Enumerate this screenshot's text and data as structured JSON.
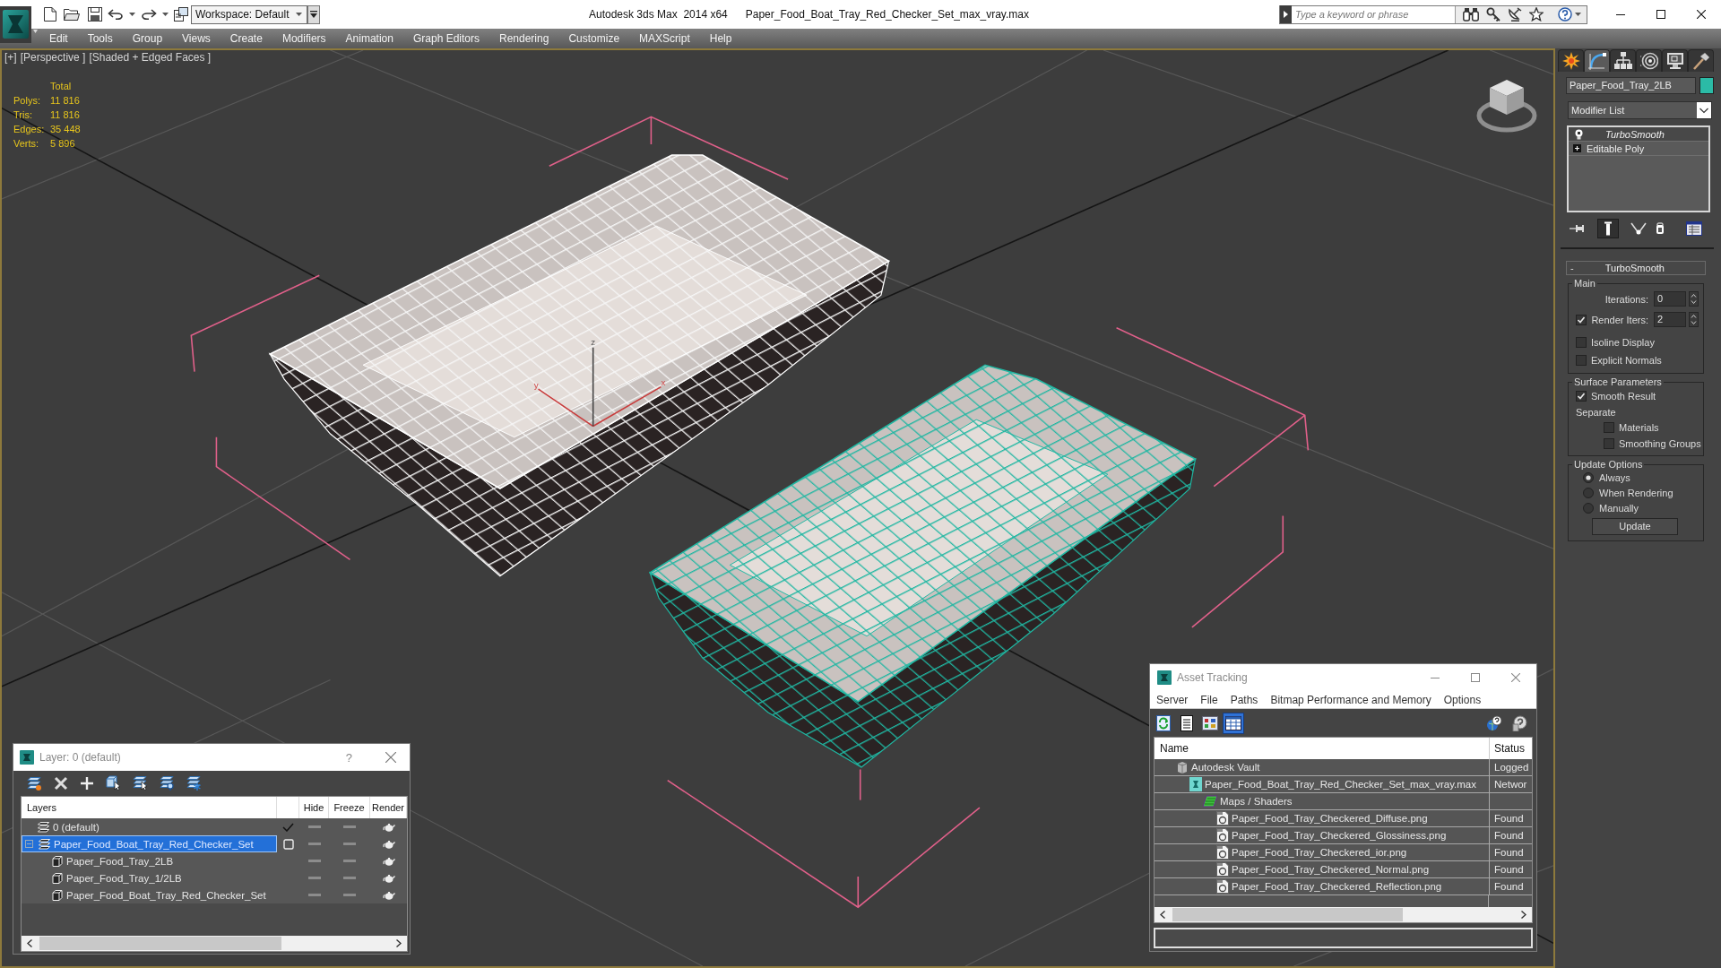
{
  "title_bar": {
    "workspace": "Workspace: Default",
    "app_title": "Autodesk 3ds Max  2014 x64",
    "file_name": "Paper_Food_Boat_Tray_Red_Checker_Set_max_vray.max",
    "search": {
      "placeholder": "Type a keyword or phrase"
    }
  },
  "menu_bar": [
    "Edit",
    "Tools",
    "Group",
    "Views",
    "Create",
    "Modifiers",
    "Animation",
    "Graph Editors",
    "Rendering",
    "Customize",
    "MAXScript",
    "Help"
  ],
  "viewport": {
    "labels": [
      "[+]",
      "[Perspective ]",
      "[Shaded + Edged Faces ]"
    ],
    "stats": {
      "header": "Total",
      "rows": [
        {
          "label": "Polys:",
          "value": "11 816"
        },
        {
          "label": "Tris:",
          "value": "11 816"
        },
        {
          "label": "Edges:",
          "value": "35 448"
        },
        {
          "label": "Verts:",
          "value": "5 896"
        }
      ]
    },
    "axis_labels": [
      "x",
      "y",
      "z"
    ],
    "objects": [
      {
        "kind": "tray",
        "selected": true
      },
      {
        "kind": "tray",
        "selected": false
      }
    ]
  },
  "command_panel": {
    "tabs": [
      {
        "kind": "create",
        "selected": false
      },
      {
        "kind": "modify",
        "selected": true
      },
      {
        "kind": "hierarchy",
        "selected": false
      },
      {
        "kind": "motion",
        "selected": false
      },
      {
        "kind": "display",
        "selected": false
      },
      {
        "kind": "utilities",
        "selected": false
      }
    ],
    "object": {
      "name": "Paper_Food_Tray_2LB",
      "color": "#2bbba6"
    },
    "modifier_list": "Modifier List",
    "stack": [
      {
        "kind": "modifier",
        "label": "TurboSmooth",
        "selected": true
      },
      {
        "kind": "base",
        "label": "Editable Poly",
        "selected": false
      }
    ],
    "stack_tools": [
      {
        "kind": "pin",
        "on": false
      },
      {
        "kind": "end_result",
        "on": true
      },
      {
        "kind": "unique",
        "on": false
      },
      {
        "kind": "remove",
        "on": false
      },
      {
        "kind": "configure",
        "on": false
      }
    ],
    "rollout": {
      "toggle": "-",
      "title": "TurboSmooth",
      "groups": [
        {
          "title": "Main",
          "controls": [
            {
              "kind": "spinner",
              "label": "Iterations:",
              "value": "0"
            },
            {
              "kind": "check_spinner",
              "label": "Render Iters:",
              "checked": true,
              "value": "2"
            },
            {
              "kind": "checkbox",
              "label": "Isoline Display",
              "checked": false
            },
            {
              "kind": "checkbox",
              "label": "Explicit Normals",
              "checked": false
            }
          ]
        },
        {
          "title": "Surface Parameters",
          "controls": [
            {
              "kind": "checkbox",
              "label": "Smooth Result",
              "checked": true
            },
            {
              "kind": "subgroup",
              "label": "Separate",
              "children": [
                {
                  "kind": "checkbox",
                  "label": "Materials",
                  "checked": false
                },
                {
                  "kind": "checkbox",
                  "label": "Smoothing Groups",
                  "checked": false
                }
              ]
            }
          ]
        },
        {
          "title": "Update Options",
          "controls": [
            {
              "kind": "radio",
              "label": "Always",
              "selected": true
            },
            {
              "kind": "radio",
              "label": "When Rendering",
              "selected": false
            },
            {
              "kind": "radio",
              "label": "Manually",
              "selected": false
            },
            {
              "kind": "button",
              "label": "Update"
            }
          ]
        }
      ]
    }
  },
  "layer_dialog": {
    "title": "Layer: 0 (default)",
    "help": "?",
    "columns": [
      "Layers",
      "Hide",
      "Freeze",
      "Render"
    ],
    "rows": [
      {
        "kind": "layer",
        "name": "0 (default)",
        "selected": false,
        "current": true,
        "hidden": false,
        "frozen": false,
        "renderable": true
      },
      {
        "kind": "layer",
        "name": "Paper_Food_Boat_Tray_Red_Checker_Set",
        "selected": true,
        "current": false,
        "expanded": true,
        "hidden": false,
        "frozen": false,
        "renderable": true,
        "children": [
          {
            "kind": "object",
            "name": "Paper_Food_Tray_2LB",
            "selected": false,
            "hidden": false,
            "frozen": false,
            "renderable": true
          },
          {
            "kind": "object",
            "name": "Paper_Food_Tray_1/2LB",
            "selected": false,
            "hidden": false,
            "frozen": false,
            "renderable": true
          },
          {
            "kind": "object",
            "name": "Paper_Food_Boat_Tray_Red_Checker_Set",
            "selected": false,
            "hidden": false,
            "frozen": false,
            "renderable": true
          }
        ]
      }
    ]
  },
  "asset_tracking": {
    "title": "Asset Tracking",
    "menu": [
      "Server",
      "File",
      "Paths",
      "Bitmap Performance and Memory",
      "Options"
    ],
    "toolbar": [
      {
        "kind": "refresh",
        "selected": false
      },
      {
        "kind": "list",
        "selected": false
      },
      {
        "kind": "thumbnails",
        "selected": false
      },
      {
        "kind": "table",
        "selected": true
      }
    ],
    "columns": [
      "Name",
      "Status"
    ],
    "rows": [
      {
        "kind": "vault",
        "name": "Autodesk Vault",
        "status": "Logged",
        "children": [
          {
            "kind": "scene",
            "name": "Paper_Food_Boat_Tray_Red_Checker_Set_max_vray.max",
            "status": "Networ",
            "children": [
              {
                "kind": "folder",
                "name": "Maps / Shaders",
                "children": [
                  {
                    "kind": "image",
                    "name": "Paper_Food_Tray_Checkered_Diffuse.png",
                    "status": "Found"
                  },
                  {
                    "kind": "image",
                    "name": "Paper_Food_Tray_Checkered_Glossiness.png",
                    "status": "Found"
                  },
                  {
                    "kind": "image",
                    "name": "Paper_Food_Tray_Checkered_ior.png",
                    "status": "Found"
                  },
                  {
                    "kind": "image",
                    "name": "Paper_Food_Tray_Checkered_Normal.png",
                    "status": "Found"
                  },
                  {
                    "kind": "image",
                    "name": "Paper_Food_Tray_Checkered_Reflection.png",
                    "status": "Found"
                  }
                ]
              }
            ]
          }
        ]
      }
    ]
  }
}
